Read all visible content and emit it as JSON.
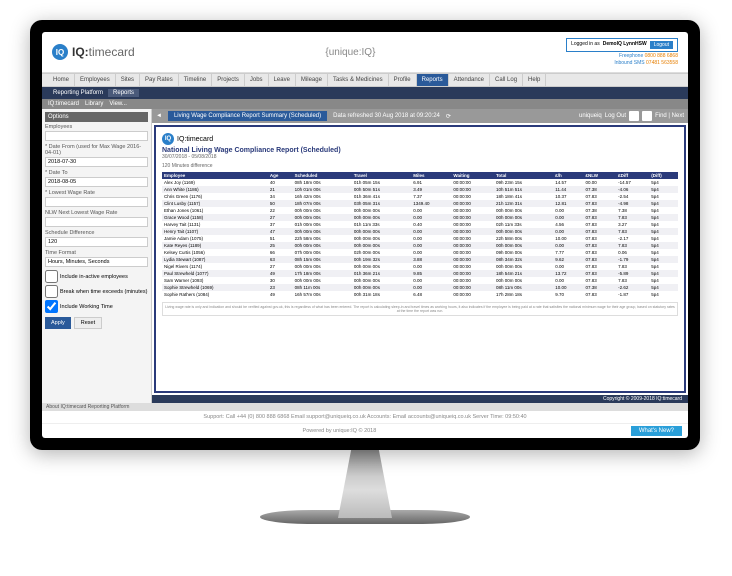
{
  "header": {
    "logo_prefix": "IQ:",
    "logo_name": "timecard",
    "center_brand": "{unique:IQ}",
    "logged_in_label": "Logged in as",
    "logged_in_user": "DemoIQ LynnHSW",
    "logout_label": "Logout",
    "freephone_label": "Freephone",
    "freephone_num": "0800 888 6868",
    "inbound_label": "Inbound SMS",
    "inbound_num": "07481 563558"
  },
  "nav": [
    "Home",
    "Employees",
    "Sites",
    "Pay Rates",
    "Timeline",
    "Projects",
    "Jobs",
    "Leave",
    "Mileage",
    "Tasks & Medicines",
    "Profile",
    "Reports",
    "Attendance",
    "Call Log",
    "Help"
  ],
  "nav_active": 11,
  "subnav": {
    "items": [
      "Reporting Platform",
      "Reports"
    ],
    "active": 1
  },
  "toolbar": {
    "left": [
      "IQ:timecard",
      "Library",
      "View..."
    ],
    "right_label": "Find | Next"
  },
  "sidebar": {
    "header": "Options",
    "employees_label": "Employees",
    "datefrom_label": "* Date From (used for Max Wage 2016-04-01)",
    "datefrom_value": "2018-07-30",
    "dateto_label": "* Date To",
    "dateto_value": "2018-08-05",
    "lowest_label": "* Lowest Wage Rate",
    "nextlowest_label": "NLW Next Lowest Wage Rate",
    "schdiff_label": "Schedule Difference",
    "schdiff_value": "120",
    "timefmt_label": "Time Format",
    "timefmt_value": "Hours, Minutes, Seconds",
    "chk1": "Include in-active employees",
    "chk2": "Break when time exceeds (minutes)",
    "chk3": "Include Working Time",
    "apply": "Apply",
    "reset": "Reset",
    "about": "About IQ:timecard Reporting Platform"
  },
  "tab": {
    "title": "Living Wage Compliance Report Summary (Scheduled)",
    "refreshed": "Data refreshed 30 Aug 2018 at 09:20:24",
    "uniqueiq": "uniqueiq",
    "logout": "Log Out"
  },
  "report": {
    "logo_text": "IQ:timecard",
    "title": "National Living Wage Compliance Report (Scheduled)",
    "daterange": "30/07/2018 - 05/08/2018",
    "subnote": "120 Minutes difference",
    "columns": [
      "Employee",
      "Age",
      "Scheduled",
      "Travel",
      "Miles",
      "Waiting",
      "Total",
      "£/h",
      "£NLW",
      "£Diff",
      "(Diff)"
    ],
    "rows": [
      [
        "Alex Joy (1169)",
        "40",
        "08h 18m 00s",
        "01h 05m 15s",
        "6.91",
        "00:00:00",
        "09h 23m 15s",
        "14.57",
        "00.00",
        "-14.57",
        "5p4"
      ],
      [
        "Ann White (1186)",
        "21",
        "10h 01m 00s",
        "00h 50m 51s",
        "3.49",
        "00:00:00",
        "10h 51m 51s",
        "11.44",
        "07.38",
        "-4.06",
        "5p4"
      ],
      [
        "Chris Green (1176)",
        "34",
        "16h 42m 00s",
        "01h 36m 41s",
        "7.37",
        "00:00:00",
        "18h 18m 41s",
        "10.37",
        "07.83",
        "-2.54",
        "5p4"
      ],
      [
        "Clint Lusby (1157)",
        "50",
        "18h 07m 00s",
        "03h 05m 31s",
        "1349.40",
        "00:00:00",
        "21h 12m 31s",
        "12.81",
        "07.83",
        "-4.98",
        "5p4"
      ],
      [
        "Ethan Jones (1061)",
        "22",
        "00h 00m 00s",
        "00h 00m 00s",
        "0.00",
        "00:00:00",
        "00h 00m 00s",
        "0.00",
        "07.38",
        "7.38",
        "5p4"
      ],
      [
        "Grace Wood (1158)",
        "27",
        "00h 00m 00s",
        "00h 00m 00s",
        "0.00",
        "00:00:00",
        "00h 00m 00s",
        "0.00",
        "07.83",
        "7.83",
        "5p4"
      ],
      [
        "Harvey Tait (1131)",
        "37",
        "01h 00m 00s",
        "01h 11m 33s",
        "0.40",
        "00:00:00",
        "02h 11m 33s",
        "4.56",
        "07.83",
        "3.27",
        "5p4"
      ],
      [
        "Henry Tait (1107)",
        "47",
        "00h 00m 00s",
        "00h 00m 00s",
        "0.00",
        "00:00:00",
        "00h 00m 00s",
        "0.00",
        "07.83",
        "7.83",
        "5p4"
      ],
      [
        "Jamie Adam (1075)",
        "51",
        "22h 58m 00s",
        "00h 00m 00s",
        "0.00",
        "00:00:00",
        "22h 58m 00s",
        "10.00",
        "07.83",
        "-2.17",
        "5p4"
      ],
      [
        "Kate Reyes (1189)",
        "25",
        "00h 00m 00s",
        "00h 00m 00s",
        "0.00",
        "00:00:00",
        "00h 00m 00s",
        "0.00",
        "07.83",
        "7.83",
        "5p4"
      ],
      [
        "Kelsey Curtis (1056)",
        "66",
        "07h 00m 00s",
        "02h 00m 00s",
        "0.00",
        "00:00:00",
        "09h 00m 00s",
        "7.77",
        "07.83",
        "0.06",
        "5p4"
      ],
      [
        "Lydia Stewart (1087)",
        "63",
        "08h 15m 00s",
        "00h 19m 32s",
        "3.88",
        "00:00:00",
        "08h 34m 32s",
        "9.62",
        "07.83",
        "-1.79",
        "5p4"
      ],
      [
        "Nigel Rivers (1174)",
        "27",
        "00h 00m 00s",
        "00h 00m 00s",
        "0.00",
        "00:00:00",
        "00h 00m 00s",
        "0.00",
        "07.83",
        "7.83",
        "5p4"
      ],
      [
        "Paul Strewheld (1077)",
        "49",
        "17h 18m 00s",
        "01h 36m 21s",
        "9.85",
        "00:00:00",
        "18h 54m 21s",
        "13.72",
        "07.83",
        "-5.89",
        "5p4"
      ],
      [
        "Sam Warner (1093)",
        "30",
        "00h 00m 00s",
        "00h 00m 00s",
        "0.00",
        "00:00:00",
        "00h 00m 00s",
        "0.00",
        "07.83",
        "7.83",
        "5p4"
      ],
      [
        "Sophie Strewheld (1069)",
        "23",
        "08h 11m 00s",
        "00h 00m 00s",
        "0.00",
        "00:00:00",
        "08h 11m 00s",
        "10.00",
        "07.38",
        "-2.62",
        "5p4"
      ],
      [
        "Sophie Rathers (1084)",
        "49",
        "16h 57m 00s",
        "00h 31m 18s",
        "6.48",
        "00:00:00",
        "17h 28m 18s",
        "9.70",
        "07.83",
        "-1.87",
        "5p4"
      ]
    ],
    "disclaimer": "Living wage rate is only and indication and should be verified against gov.uk, this is regardless of what has been entered. The report is calculating sleep-in and travel times as working hours, it also indicates if the employee is being paid at a rate that satisfies the national minimum wage for their age group, based on statutory rates at the time the report was run."
  },
  "footers": {
    "copyright": "Copyright © 2009-2018 IQ:timecard",
    "support": "Support:   Call  +44 (0) 800 888 6868    Email  support@uniqueiq.co.uk      Accounts:   Email   accounts@uniqueiq.co.uk      Server Time:   09:50:40",
    "powered": "Powered by unique:IQ © 2018",
    "whatsnew": "What's New?"
  }
}
